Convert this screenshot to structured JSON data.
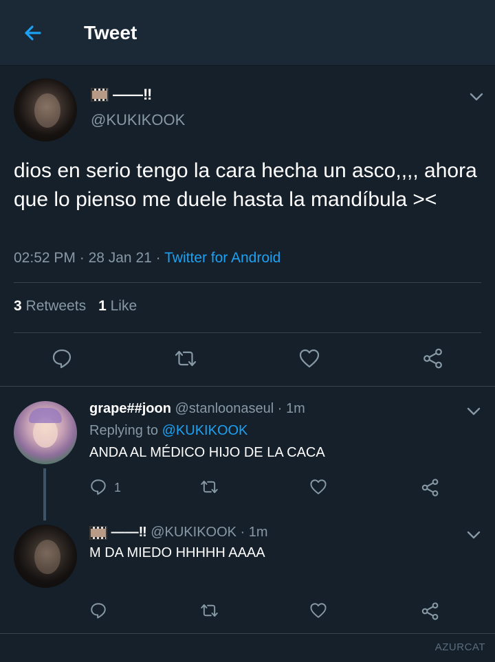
{
  "header": {
    "title": "Tweet"
  },
  "tweet": {
    "display_name": "——‼",
    "handle": "@KUKIKOOK",
    "text": "dios en serio tengo la cara hecha un asco,,,, ahora que lo pienso me duele hasta la mandíbula ><",
    "time": "02:52 PM",
    "date": "28 Jan 21",
    "source": "Twitter for Android",
    "retweets_count": "3",
    "retweets_label": "Retweets",
    "likes_count": "1",
    "likes_label": "Like"
  },
  "replies": [
    {
      "display_name": "grape##joon",
      "handle": "@stanloonaseul",
      "time": "1m",
      "replying_prefix": "Replying to",
      "replying_to": "@KUKIKOOK",
      "text": "ANDA AL MÉDICO HIJO DE LA CACA",
      "reply_count": "1"
    },
    {
      "display_name": "——‼",
      "handle": "@KUKIKOOK",
      "time": "1m",
      "text": "M DA MIEDO HHHHH AAAA"
    }
  ],
  "separator": " · ",
  "watermark": "AZURCAT",
  "icons": {
    "back": "arrow-left-icon",
    "chevron": "chevron-down-icon",
    "reply": "reply-icon",
    "retweet": "retweet-icon",
    "like": "heart-icon",
    "share": "share-icon",
    "emoji": "film-frame-icon"
  },
  "colors": {
    "background": "#15202b",
    "header": "#1b2836",
    "accent": "#1da1f2",
    "muted": "#8899a6",
    "divider": "#38444d"
  }
}
